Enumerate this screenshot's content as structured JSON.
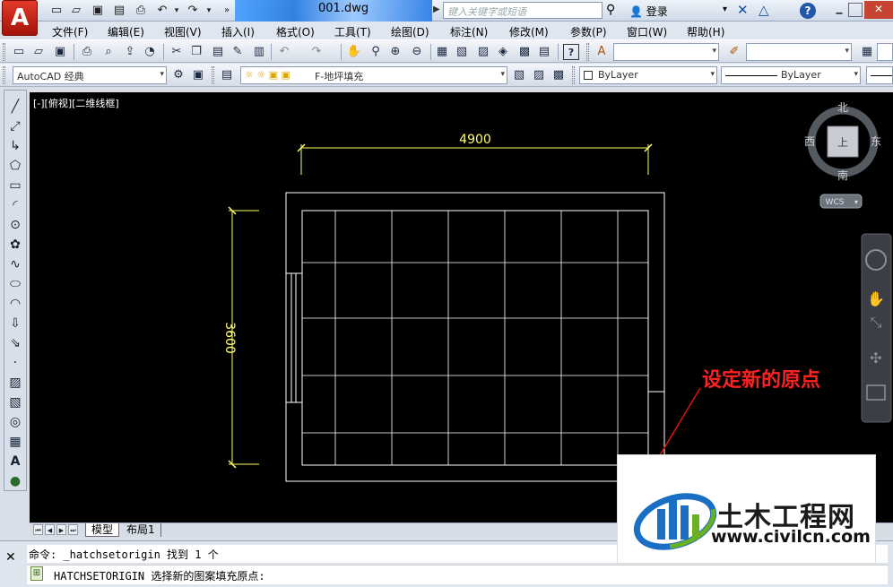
{
  "window": {
    "title": "001.dwg",
    "search_placeholder": "键入关键字或短语",
    "login": "登录",
    "help": "?"
  },
  "menubar": {
    "items": [
      "文件(F)",
      "编辑(E)",
      "视图(V)",
      "插入(I)",
      "格式(O)",
      "工具(T)",
      "绘图(D)",
      "标注(N)",
      "修改(M)",
      "参数(P)",
      "窗口(W)",
      "帮助(H)"
    ]
  },
  "toolbar2": {
    "workspace": "AutoCAD 经典",
    "layer": "F-地坪填充",
    "color": "ByLayer",
    "linetype": "ByLayer"
  },
  "viewport": {
    "label": "[-][俯视][二维线框]",
    "dim_horizontal": "4900",
    "dim_vertical": "3600",
    "annotation": "设定新的原点",
    "colors": {
      "wall": "#ffffff",
      "dimension": "#ffff66",
      "annotation": "#ff2020",
      "leader": "#e01010",
      "background": "#000000"
    }
  },
  "viewcube": {
    "north": "北",
    "south": "南",
    "east": "东",
    "west": "西",
    "face": "上",
    "wcs": "WCS"
  },
  "tabs": {
    "model": "模型",
    "layout": "布局1"
  },
  "command": {
    "history": "命令: _hatchsetorigin 找到 1 个",
    "prompt": "HATCHSETORIGIN 选择新的图案填充原点:"
  },
  "watermark": {
    "name": "土木工程网",
    "url": "www.civilcn.com",
    "colors": {
      "blue": "#1a6fc4",
      "green": "#6ab023"
    }
  }
}
